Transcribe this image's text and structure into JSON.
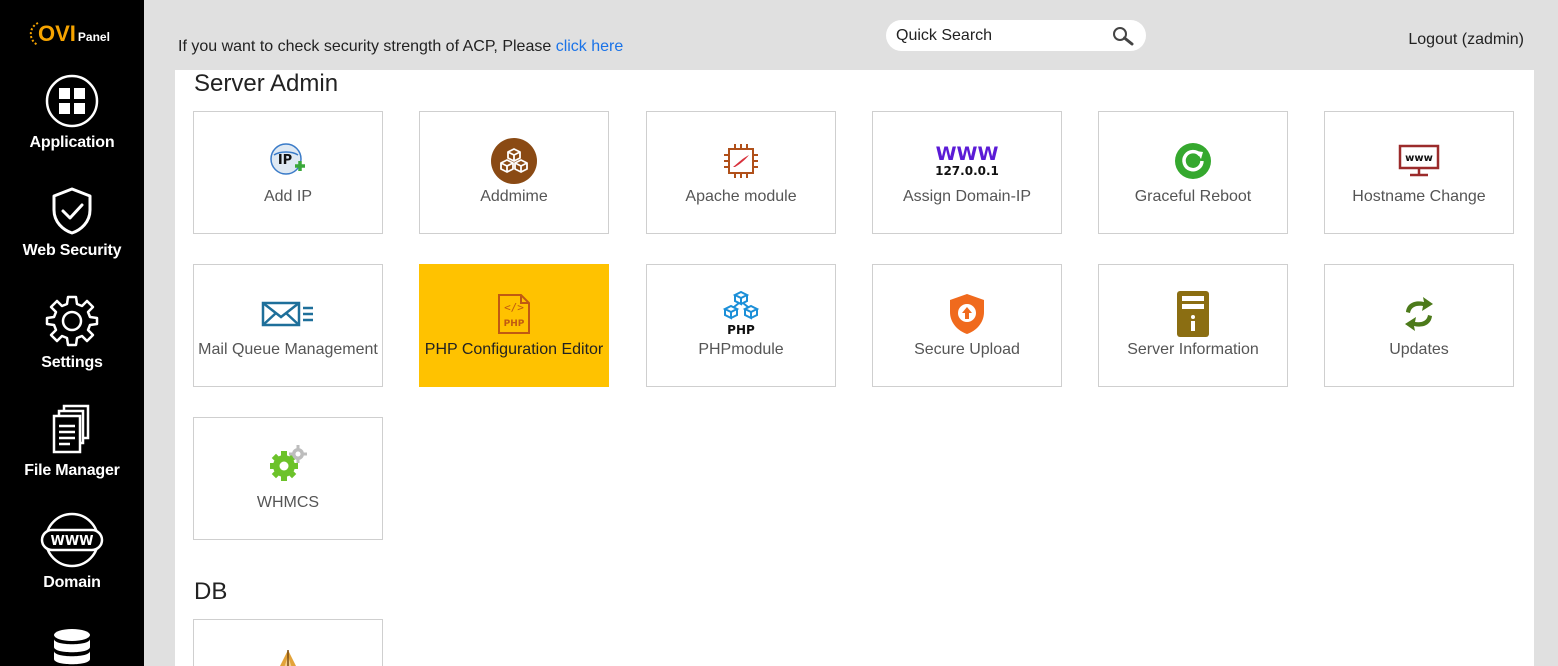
{
  "brand": {
    "logo_main": "OVI",
    "logo_sub": "Panel"
  },
  "sidebar": {
    "items": [
      {
        "label": "Application",
        "icon": "grid-icon"
      },
      {
        "label": "Web Security",
        "icon": "shield-check-icon"
      },
      {
        "label": "Settings",
        "icon": "gear-icon"
      },
      {
        "label": "File Manager",
        "icon": "files-icon"
      },
      {
        "label": "Domain",
        "icon": "www-icon"
      },
      {
        "label": "",
        "icon": "database-icon"
      }
    ]
  },
  "header": {
    "security_text": "If you want to check security strength of ACP, Please ",
    "security_link": "click here",
    "search_placeholder": "Quick Search",
    "logout_label": "Logout (zadmin)"
  },
  "sections": [
    {
      "title": "Server Admin",
      "tiles": [
        {
          "label": "Add IP",
          "icon": "add-ip-icon"
        },
        {
          "label": "Addmime",
          "icon": "addmime-icon"
        },
        {
          "label": "Apache module",
          "icon": "apache-module-icon"
        },
        {
          "label": "Assign Domain-IP",
          "icon": "assign-domain-ip-icon",
          "icon_text_top": "WWW",
          "icon_text_bottom": "127.0.0.1"
        },
        {
          "label": "Graceful Reboot",
          "icon": "reboot-icon"
        },
        {
          "label": "Hostname Change",
          "icon": "hostname-icon",
          "icon_text": "www"
        },
        {
          "label": "Mail Queue Management",
          "icon": "mail-queue-icon"
        },
        {
          "label": "PHP Configuration Editor",
          "icon": "php-config-icon",
          "icon_text": "PHP",
          "active": true
        },
        {
          "label": "PHPmodule",
          "icon": "php-module-icon",
          "icon_text": "PHP"
        },
        {
          "label": "Secure Upload",
          "icon": "secure-upload-icon"
        },
        {
          "label": "Server Information",
          "icon": "server-info-icon"
        },
        {
          "label": "Updates",
          "icon": "updates-icon"
        },
        {
          "label": "WHMCS",
          "icon": "whmcs-icon"
        }
      ]
    },
    {
      "title": "DB",
      "tiles": [
        {
          "label": "",
          "icon": "db-tool-icon"
        }
      ]
    }
  ],
  "colors": {
    "accent_active": "#ffc200",
    "link": "#1a73e8",
    "sidebar_bg": "#000000"
  }
}
